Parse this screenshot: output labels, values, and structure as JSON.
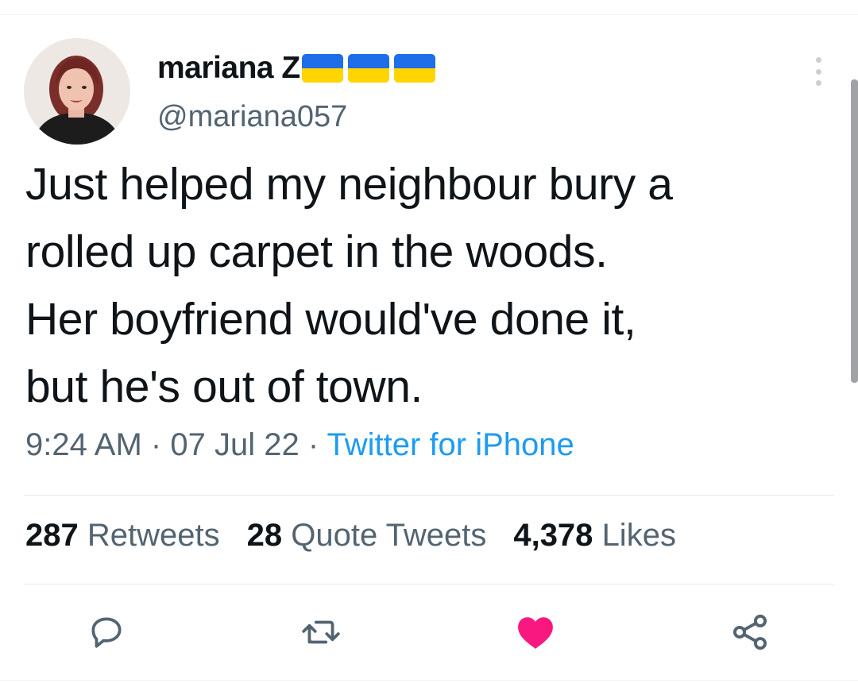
{
  "author": {
    "display_name": "mariana Z",
    "handle": "@mariana057",
    "flags": [
      "ukraine-flag",
      "ukraine-flag",
      "ukraine-flag"
    ]
  },
  "tweet": {
    "text": "Just helped my neighbour bury a\nrolled up carpet in the woods.\nHer boyfriend would've done it,\nbut he's out of town.",
    "time": "9:24 AM",
    "separator": "·",
    "date": "07 Jul 22",
    "source": "Twitter for iPhone"
  },
  "stats": {
    "retweets_count": "287",
    "retweets_label": "Retweets",
    "quotes_count": "28",
    "quotes_label": "Quote Tweets",
    "likes_count": "4,378",
    "likes_label": "Likes"
  },
  "actions": {
    "reply_icon": "reply-icon",
    "retweet_icon": "retweet-icon",
    "like_icon": "heart-icon",
    "share_icon": "share-icon",
    "liked": true
  },
  "colors": {
    "text": "#0f1419",
    "secondary_text": "#536471",
    "link": "#1d9bf0",
    "like": "#f91880",
    "flag_blue": "#1d6ee8",
    "flag_yellow": "#ffd500"
  }
}
